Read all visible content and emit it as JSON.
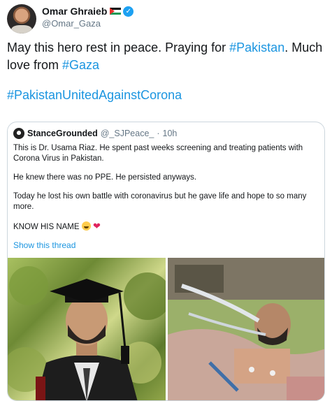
{
  "author": {
    "display_name": "Omar Ghraieb",
    "handle": "@Omar_Gaza",
    "verified": true
  },
  "tweet": {
    "line1_pre": "May this hero rest in peace. Praying for ",
    "line1_tag": "#Pakistan",
    "line1_post": ". Much love from ",
    "line2_tag": "#Gaza",
    "line3_tag": "#PakistanUnitedAgainstCorona"
  },
  "quote": {
    "display_name": "StanceGrounded",
    "handle": "@_SJPeace_",
    "separator": "·",
    "time": "10h",
    "paragraphs": [
      "This is Dr. Usama Riaz. He spent past weeks screening and treating patients with Corona Virus in Pakistan.",
      "He knew there was no PPE. He persisted anyways.",
      "Today he lost his own battle with coronavirus but he gave life and hope to so many more."
    ],
    "closing": "KNOW HIS NAME",
    "show_thread": "Show this thread"
  },
  "colors": {
    "link": "#1b95e0",
    "verified": "#1da1f2",
    "border": "#ccd6dd",
    "muted": "#657786"
  }
}
